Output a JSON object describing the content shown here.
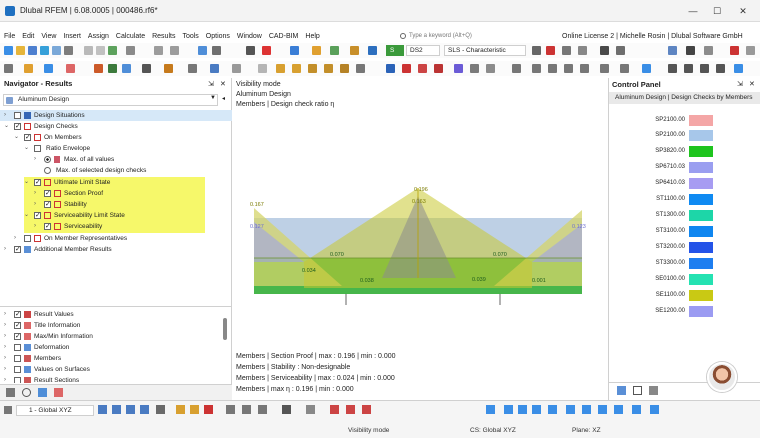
{
  "window": {
    "title": "Dlubal RFEM | 6.08.0005 | 000486.rf6*",
    "minimize": "—",
    "maximize": "☐",
    "close": "✕"
  },
  "menu": [
    "File",
    "Edit",
    "View",
    "Insert",
    "Assign",
    "Calculate",
    "Results",
    "Tools",
    "Options",
    "Window",
    "CAD-BIM",
    "Help"
  ],
  "search": {
    "placeholder": "Type a keyword (Alt+Q)"
  },
  "license": "Online License 2 | Michelle Rosin | Dlubal Software GmbH",
  "toolbar": {
    "load_case_type": "S Ch",
    "load_case_id": "DS2",
    "load_case_name": "SLS - Characteristic"
  },
  "navigator": {
    "title": "Navigator - Results",
    "module": "Aluminum Design",
    "tree": [
      {
        "label": "Design Situations",
        "checked": false
      },
      {
        "label": "Design Checks",
        "checked": true
      },
      {
        "label": "On Members",
        "checked": true
      },
      {
        "label": "Ratio Envelope",
        "checked": false
      },
      {
        "label": "Max. of all values",
        "radio": true
      },
      {
        "label": "Max. of selected design checks",
        "radio": false
      },
      {
        "label": "Ultimate Limit State",
        "checked": true
      },
      {
        "label": "Section Proof",
        "checked": true
      },
      {
        "label": "Stability",
        "checked": true
      },
      {
        "label": "Serviceability Limit State",
        "checked": true
      },
      {
        "label": "Serviceability",
        "checked": true
      },
      {
        "label": "On Member Representatives",
        "checked": false
      },
      {
        "label": "Additional Member Results",
        "checked": true
      }
    ],
    "tree2": [
      {
        "label": "Result Values",
        "checked": true
      },
      {
        "label": "Title Information",
        "checked": true
      },
      {
        "label": "Max/Min Information",
        "checked": true
      },
      {
        "label": "Deformation",
        "checked": false
      },
      {
        "label": "Members",
        "checked": false
      },
      {
        "label": "Values on Surfaces",
        "checked": false
      },
      {
        "label": "Result Sections",
        "checked": false
      }
    ]
  },
  "view": {
    "mode": "Visibility mode",
    "module": "Aluminum Design",
    "result": "Members | Design check ratio η",
    "summary": [
      "Members | Section Proof | max : 0.196 | min : 0.000",
      "Members | Stability : Non-designable",
      "Members | Serviceability | max : 0.024 | min : 0.000",
      "Members | max η : 0.196 | min : 0.000"
    ],
    "values": [
      "0.167",
      "0.196",
      "0.163",
      "0.070",
      "0.070",
      "0.039",
      "0.038",
      "0.034",
      "0.123",
      "0.127",
      "0.001"
    ]
  },
  "control_panel": {
    "title": "Control Panel",
    "subtitle": "Aluminum Design | Design Checks by Members",
    "legend": [
      {
        "label": "SP2100.00",
        "color": "#f4a6a6"
      },
      {
        "label": "SP2100.00",
        "color": "#a7c7ea"
      },
      {
        "label": "SP3820.00",
        "color": "#1ec41e"
      },
      {
        "label": "SP6710.03",
        "color": "#9a9ef0"
      },
      {
        "label": "SP6410.03",
        "color": "#a79cf2"
      },
      {
        "label": "ST1100.00",
        "color": "#0f8af2"
      },
      {
        "label": "ST1300.00",
        "color": "#1dd6a8"
      },
      {
        "label": "ST3100.00",
        "color": "#0f86f0"
      },
      {
        "label": "ST3200.00",
        "color": "#2453e8"
      },
      {
        "label": "ST3300.00",
        "color": "#1e7ef0"
      },
      {
        "label": "SE0100.00",
        "color": "#24e2b2"
      },
      {
        "label": "SE1100.00",
        "color": "#c9c914"
      },
      {
        "label": "SE1200.00",
        "color": "#9b9bf2"
      }
    ]
  },
  "status": {
    "coordinate_system": "1 - Global XYZ",
    "mode": "Visibility mode",
    "cs": "CS: Global XYZ",
    "plane": "Plane: XZ"
  }
}
